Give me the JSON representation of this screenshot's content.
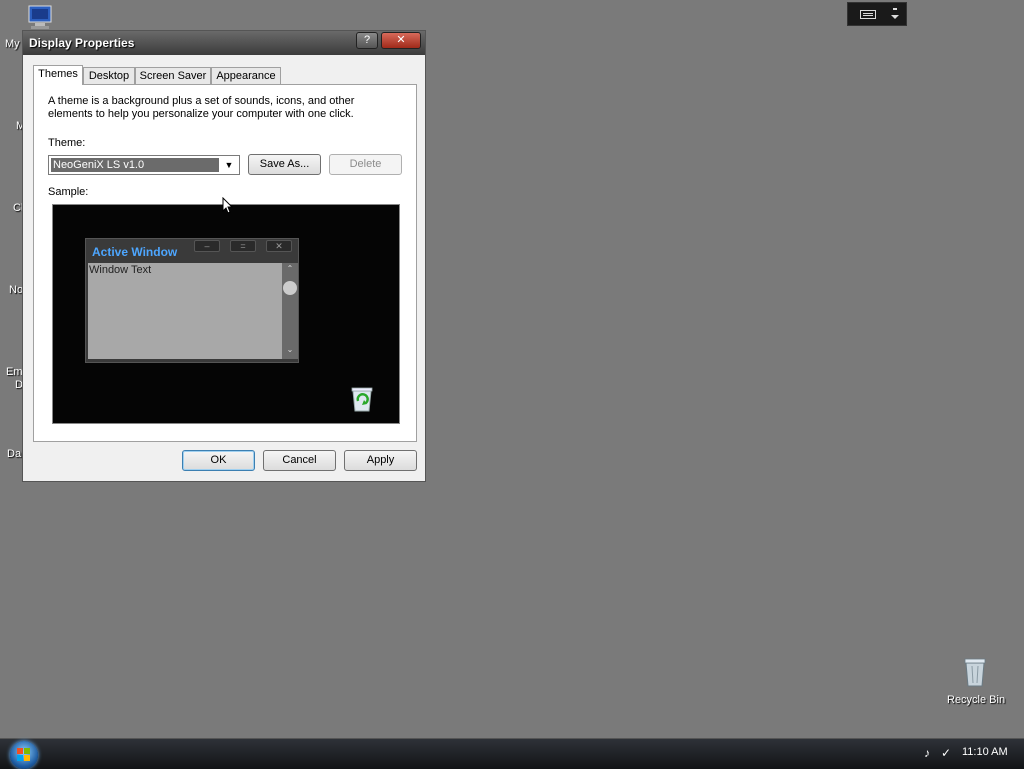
{
  "desktop": {
    "clipped_labels": [
      "My",
      "M",
      "Cl",
      "No",
      "Em",
      "D",
      "Da"
    ],
    "recycle_bin_label": "Recycle Bin"
  },
  "dialog": {
    "title": "Display Properties",
    "help_label": "?",
    "close_label": "✕",
    "tabs": [
      {
        "label": "Themes",
        "active": true
      },
      {
        "label": "Desktop",
        "active": false
      },
      {
        "label": "Screen Saver",
        "active": false
      },
      {
        "label": "Appearance",
        "active": false
      }
    ],
    "description": "A theme is a background plus a set of sounds, icons, and other elements to help you personalize your computer with one click.",
    "theme_label": "Theme:",
    "theme_value": "NeoGeniX LS v1.0",
    "save_as_label": "Save As...",
    "delete_label": "Delete",
    "sample_label": "Sample:",
    "sample": {
      "active_window_title": "Active Window",
      "window_text": "Window Text"
    },
    "ok_label": "OK",
    "cancel_label": "Cancel",
    "apply_label": "Apply"
  },
  "taskbar": {
    "clock": "11:10 AM"
  },
  "colors": {
    "desktop": "#7a7a7a",
    "titlebar": "#4b4b4b",
    "accent_title": "#4da6ff"
  }
}
